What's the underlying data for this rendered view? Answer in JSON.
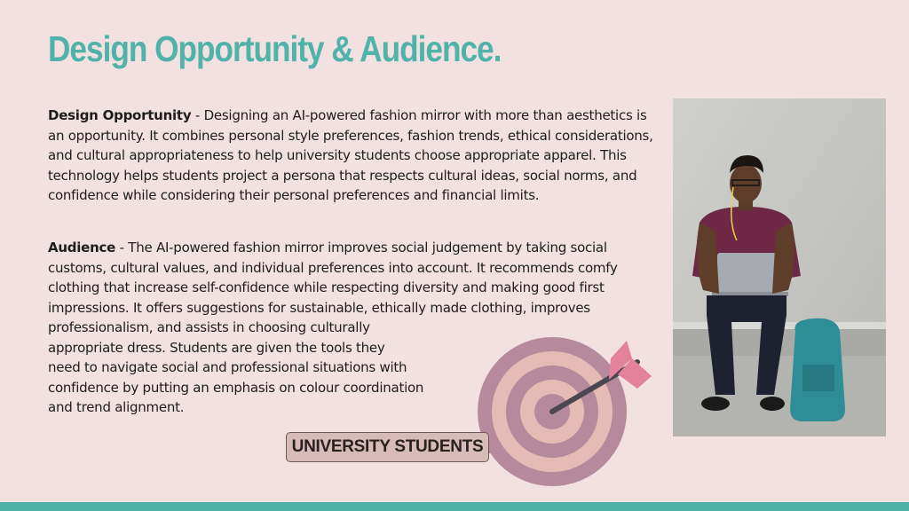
{
  "slide": {
    "title": "Design Opportunity & Audience.",
    "design_opportunity": {
      "label": "Design Opportunity",
      "text": " - Designing an AI-powered fashion mirror with more than aesthetics is an opportunity. It combines personal style preferences, fashion trends, ethical considerations, and cultural appropriateness to help university students choose appropriate apparel. This technology helps students project a persona that respects cultural ideas, social norms, and confidence while considering their personal preferences and financial limits."
    },
    "audience": {
      "label": "Audience",
      "lines": [
        " - The AI-powered fashion mirror improves social judgement by taking social",
        "customs, cultural values, and individual preferences into account. It recommends comfy",
        "clothing that increase self-confidence while respecting diversity and making good first",
        "impressions. It offers suggestions for sustainable, ethically made clothing, improves",
        "professionalism, and assists in choosing culturally",
        "appropriate dress. Students are given the tools they",
        "need to navigate social and professional situations with",
        "confidence by putting an emphasis on colour coordination",
        "and trend alignment."
      ]
    },
    "target_label": "UNIVERSITY STUDENTS"
  },
  "colors": {
    "background": "#f3e1e1",
    "accent": "#4fb3a9",
    "target_outer": "#b48a9c",
    "target_inner": "#e7bbb5",
    "arrow_fletching": "#e3829a"
  },
  "icons": {
    "target": "target-icon",
    "arrow": "arrow-icon"
  }
}
